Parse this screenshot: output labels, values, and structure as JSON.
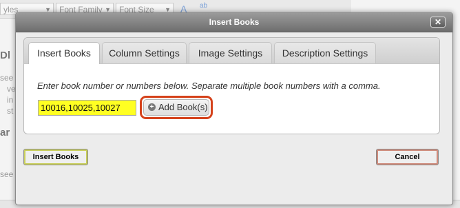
{
  "background": {
    "toolbar": {
      "styles_label": "yles",
      "font_family": "Font Family",
      "font_size": "Font Size",
      "text_color_icon": "A",
      "highlight_icon": "ab"
    },
    "left_fragments": [
      "Dl",
      "see",
      "ve",
      "in",
      "st",
      "ar",
      "see"
    ]
  },
  "dialog": {
    "title": "Insert Books",
    "close_icon": "✕",
    "tabs": [
      {
        "label": "Insert Books",
        "active": true
      },
      {
        "label": "Column Settings",
        "active": false
      },
      {
        "label": "Image Settings",
        "active": false
      },
      {
        "label": "Description Settings",
        "active": false
      }
    ],
    "instruction": "Enter book number or numbers below. Separate multiple book numbers with a comma.",
    "book_numbers_value": "10016,10025,10027",
    "add_button_label": "Add Book(s)",
    "footer": {
      "insert_label": "Insert Books",
      "cancel_label": "Cancel"
    }
  },
  "colors": {
    "input_highlight": "#ffff22",
    "callout_border": "#d5421b",
    "titlebar": "#7a7a7a"
  }
}
